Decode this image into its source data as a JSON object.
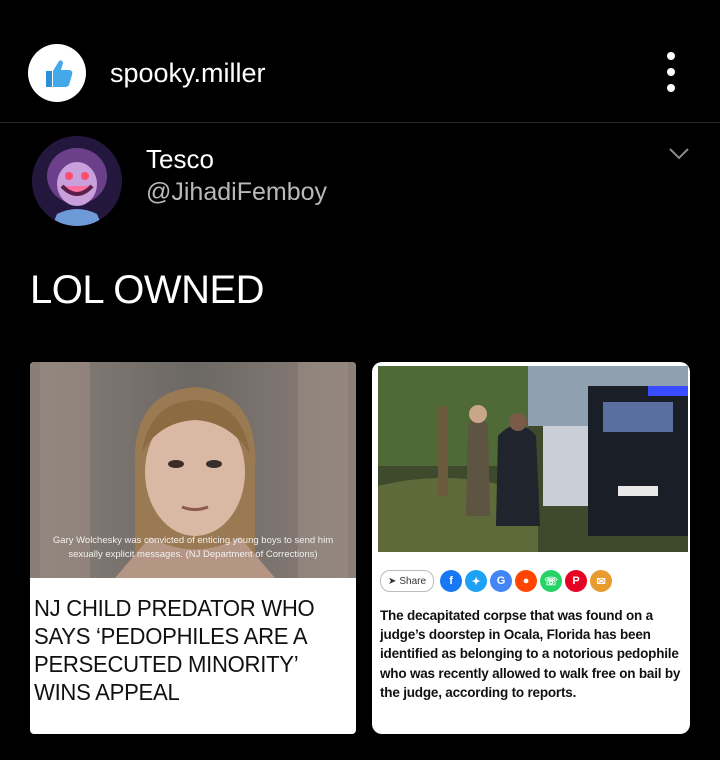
{
  "post": {
    "username": "spooky.miller",
    "menu_icon": "more-vertical-icon"
  },
  "tweet": {
    "name": "Tesco",
    "handle": "@JihadiFemboy",
    "text": "LOL OWNED"
  },
  "article_left": {
    "caption_line1": "Gary Wolchesky was convicted of enticing young boys to send him",
    "caption_line2": "sexually explicit messages. (NJ Department of Corrections)",
    "headline_lines": [
      "NJ CHILD PREDATOR WHO",
      "SAYS ‘PEDOPHILES ARE A",
      "PERSECUTED MINORITY’",
      "WINS APPEAL"
    ]
  },
  "article_right": {
    "share_label": "Share",
    "social_icons": [
      "facebook-icon",
      "twitter-icon",
      "google-icon",
      "reddit-icon",
      "whatsapp-icon",
      "pinterest-icon",
      "email-icon"
    ],
    "social_colors": [
      "#1877f2",
      "#1da1f2",
      "#4285f4",
      "#ff4500",
      "#25d366",
      "#e60023",
      "#e89b2f"
    ],
    "body": "The decapitated corpse that was found on a judge’s doorstep in Ocala, Florida has been identified as belonging to a notorious pedophile who was recently allowed to walk free on bail by the judge, according to reports."
  }
}
